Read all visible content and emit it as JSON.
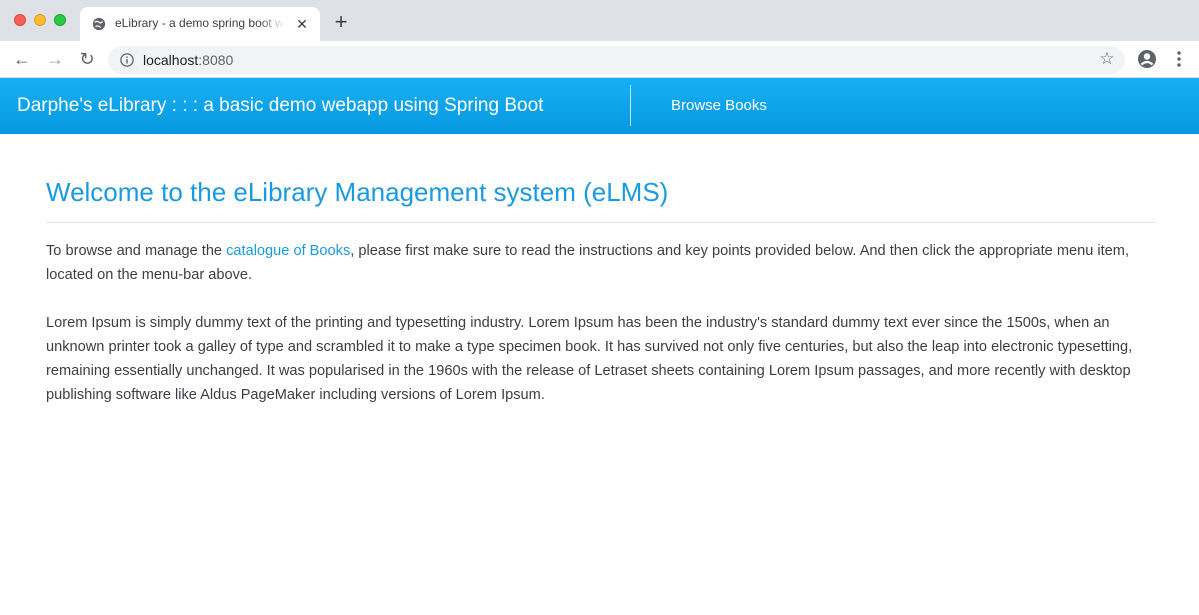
{
  "browser": {
    "tab_title": "eLibrary - a demo spring boot webapp",
    "new_tab_label": "+",
    "url_host": "localhost",
    "url_port": ":8080"
  },
  "navbar": {
    "brand": "Darphe's eLibrary : : : a basic demo webapp using Spring Boot",
    "links": [
      {
        "label": "Browse Books"
      }
    ]
  },
  "page": {
    "heading": "Welcome to the eLibrary Management system (eLMS)",
    "intro": {
      "before_link": "To browse and manage the ",
      "link_text": "catalogue of Books",
      "after_link": ", please first make sure to read the instructions and key points provided below. And then click the appropriate menu item, located on the menu-bar above."
    },
    "body": "Lorem Ipsum is simply dummy text of the printing and typesetting industry. Lorem Ipsum has been the industry's standard dummy text ever since the 1500s, when an unknown printer took a galley of type and scrambled it to make a type specimen book. It has survived not only five centuries, but also the leap into electronic typesetting, remaining essentially unchanged. It was popularised in the 1960s with the release of Letraset sheets containing Lorem Ipsum passages, and more recently with desktop publishing software like Aldus PageMaker including versions of Lorem Ipsum."
  },
  "icons": {
    "favicon": "globe-icon",
    "tab_close": "close-icon",
    "back": "arrow-left-icon",
    "forward": "arrow-right-icon",
    "reload": "reload-icon",
    "site_info": "info-icon",
    "bookmark": "star-icon",
    "profile": "profile-icon",
    "menu": "kebab-menu-icon"
  },
  "colors": {
    "navbar": "#0aa1e8",
    "accent": "#1a9ae0",
    "text": "#3a3f44"
  }
}
